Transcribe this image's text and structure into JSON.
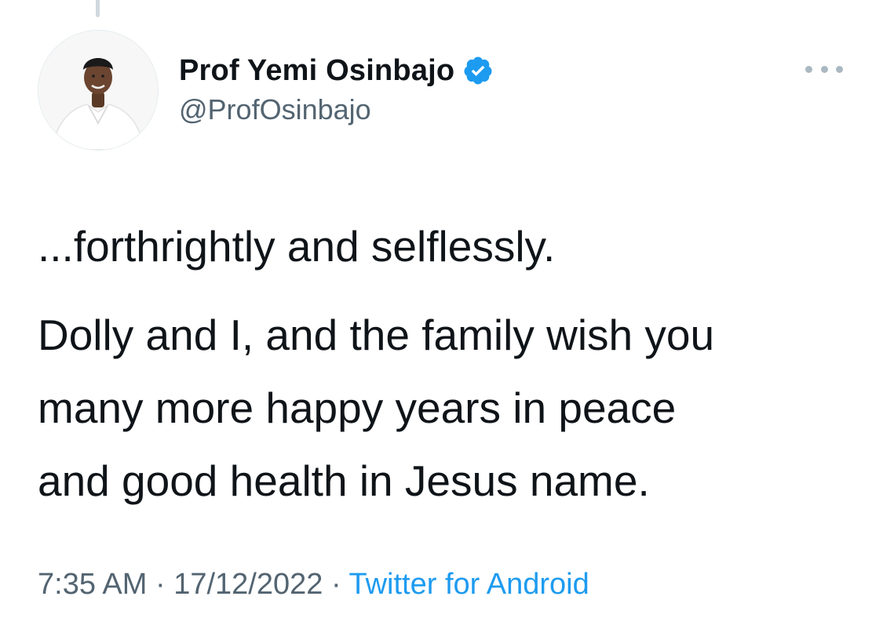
{
  "tweet": {
    "author": {
      "display_name": "Prof Yemi Osinbajo",
      "handle": "@ProfOsinbajo",
      "verified": true,
      "avatar_icon": "profile-photo"
    },
    "text": {
      "paragraph_1": "...forthrightly and selflessly.",
      "paragraph_2": "Dolly and I, and the family wish you\nmany more happy years in peace\nand good health in Jesus name."
    },
    "meta": {
      "time": "7:35 AM",
      "separator": " · ",
      "date": "17/12/2022",
      "source": "Twitter for Android"
    },
    "more_icon": "ellipsis-icon"
  },
  "colors": {
    "text_primary": "#0f1419",
    "text_secondary": "#536471",
    "link": "#1d9bf0",
    "verified_badge": "#1d9bf0",
    "more_dots": "#aab8c2"
  }
}
